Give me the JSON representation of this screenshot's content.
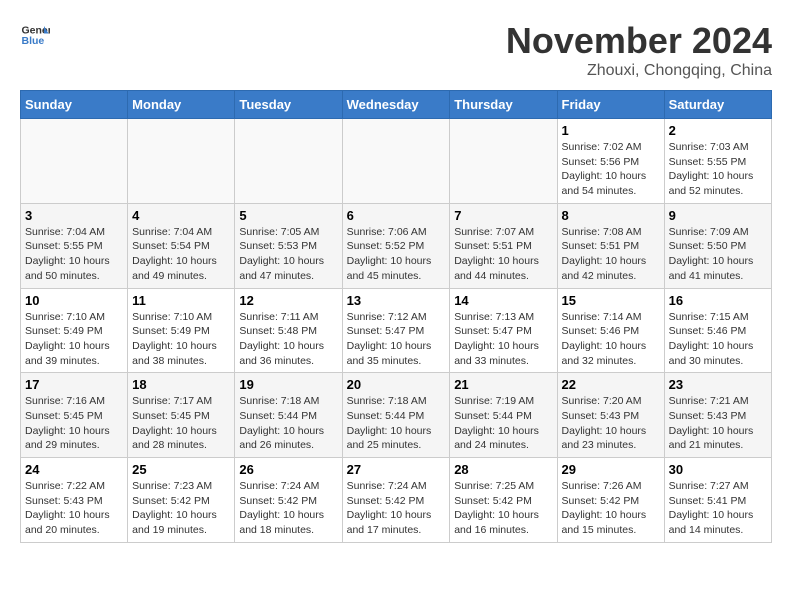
{
  "header": {
    "logo_line1": "General",
    "logo_line2": "Blue",
    "title": "November 2024",
    "subtitle": "Zhouxi, Chongqing, China"
  },
  "columns": [
    "Sunday",
    "Monday",
    "Tuesday",
    "Wednesday",
    "Thursday",
    "Friday",
    "Saturday"
  ],
  "weeks": [
    [
      {
        "day": "",
        "info": ""
      },
      {
        "day": "",
        "info": ""
      },
      {
        "day": "",
        "info": ""
      },
      {
        "day": "",
        "info": ""
      },
      {
        "day": "",
        "info": ""
      },
      {
        "day": "1",
        "info": "Sunrise: 7:02 AM\nSunset: 5:56 PM\nDaylight: 10 hours and 54 minutes."
      },
      {
        "day": "2",
        "info": "Sunrise: 7:03 AM\nSunset: 5:55 PM\nDaylight: 10 hours and 52 minutes."
      }
    ],
    [
      {
        "day": "3",
        "info": "Sunrise: 7:04 AM\nSunset: 5:55 PM\nDaylight: 10 hours and 50 minutes."
      },
      {
        "day": "4",
        "info": "Sunrise: 7:04 AM\nSunset: 5:54 PM\nDaylight: 10 hours and 49 minutes."
      },
      {
        "day": "5",
        "info": "Sunrise: 7:05 AM\nSunset: 5:53 PM\nDaylight: 10 hours and 47 minutes."
      },
      {
        "day": "6",
        "info": "Sunrise: 7:06 AM\nSunset: 5:52 PM\nDaylight: 10 hours and 45 minutes."
      },
      {
        "day": "7",
        "info": "Sunrise: 7:07 AM\nSunset: 5:51 PM\nDaylight: 10 hours and 44 minutes."
      },
      {
        "day": "8",
        "info": "Sunrise: 7:08 AM\nSunset: 5:51 PM\nDaylight: 10 hours and 42 minutes."
      },
      {
        "day": "9",
        "info": "Sunrise: 7:09 AM\nSunset: 5:50 PM\nDaylight: 10 hours and 41 minutes."
      }
    ],
    [
      {
        "day": "10",
        "info": "Sunrise: 7:10 AM\nSunset: 5:49 PM\nDaylight: 10 hours and 39 minutes."
      },
      {
        "day": "11",
        "info": "Sunrise: 7:10 AM\nSunset: 5:49 PM\nDaylight: 10 hours and 38 minutes."
      },
      {
        "day": "12",
        "info": "Sunrise: 7:11 AM\nSunset: 5:48 PM\nDaylight: 10 hours and 36 minutes."
      },
      {
        "day": "13",
        "info": "Sunrise: 7:12 AM\nSunset: 5:47 PM\nDaylight: 10 hours and 35 minutes."
      },
      {
        "day": "14",
        "info": "Sunrise: 7:13 AM\nSunset: 5:47 PM\nDaylight: 10 hours and 33 minutes."
      },
      {
        "day": "15",
        "info": "Sunrise: 7:14 AM\nSunset: 5:46 PM\nDaylight: 10 hours and 32 minutes."
      },
      {
        "day": "16",
        "info": "Sunrise: 7:15 AM\nSunset: 5:46 PM\nDaylight: 10 hours and 30 minutes."
      }
    ],
    [
      {
        "day": "17",
        "info": "Sunrise: 7:16 AM\nSunset: 5:45 PM\nDaylight: 10 hours and 29 minutes."
      },
      {
        "day": "18",
        "info": "Sunrise: 7:17 AM\nSunset: 5:45 PM\nDaylight: 10 hours and 28 minutes."
      },
      {
        "day": "19",
        "info": "Sunrise: 7:18 AM\nSunset: 5:44 PM\nDaylight: 10 hours and 26 minutes."
      },
      {
        "day": "20",
        "info": "Sunrise: 7:18 AM\nSunset: 5:44 PM\nDaylight: 10 hours and 25 minutes."
      },
      {
        "day": "21",
        "info": "Sunrise: 7:19 AM\nSunset: 5:44 PM\nDaylight: 10 hours and 24 minutes."
      },
      {
        "day": "22",
        "info": "Sunrise: 7:20 AM\nSunset: 5:43 PM\nDaylight: 10 hours and 23 minutes."
      },
      {
        "day": "23",
        "info": "Sunrise: 7:21 AM\nSunset: 5:43 PM\nDaylight: 10 hours and 21 minutes."
      }
    ],
    [
      {
        "day": "24",
        "info": "Sunrise: 7:22 AM\nSunset: 5:43 PM\nDaylight: 10 hours and 20 minutes."
      },
      {
        "day": "25",
        "info": "Sunrise: 7:23 AM\nSunset: 5:42 PM\nDaylight: 10 hours and 19 minutes."
      },
      {
        "day": "26",
        "info": "Sunrise: 7:24 AM\nSunset: 5:42 PM\nDaylight: 10 hours and 18 minutes."
      },
      {
        "day": "27",
        "info": "Sunrise: 7:24 AM\nSunset: 5:42 PM\nDaylight: 10 hours and 17 minutes."
      },
      {
        "day": "28",
        "info": "Sunrise: 7:25 AM\nSunset: 5:42 PM\nDaylight: 10 hours and 16 minutes."
      },
      {
        "day": "29",
        "info": "Sunrise: 7:26 AM\nSunset: 5:42 PM\nDaylight: 10 hours and 15 minutes."
      },
      {
        "day": "30",
        "info": "Sunrise: 7:27 AM\nSunset: 5:41 PM\nDaylight: 10 hours and 14 minutes."
      }
    ]
  ]
}
